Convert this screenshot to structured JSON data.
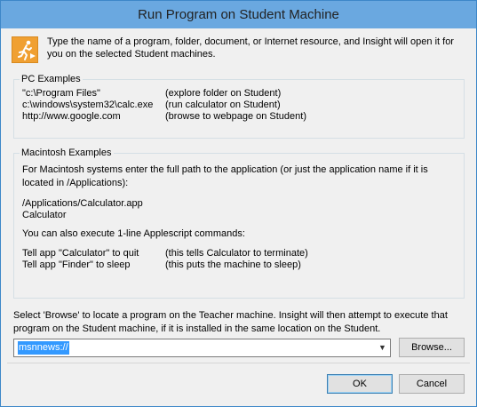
{
  "window": {
    "title": "Run Program on Student Machine"
  },
  "intro": "Type the name of a program, folder, document, or Internet resource, and Insight will open it for you on the selected Student machines.",
  "pc": {
    "label": "PC Examples",
    "rows": [
      {
        "cmd": "\"c:\\Program Files\"",
        "desc": "(explore folder on Student)"
      },
      {
        "cmd": "c:\\windows\\system32\\calc.exe",
        "desc": "(run calculator on Student)"
      },
      {
        "cmd": "http://www.google.com",
        "desc": "(browse to webpage on Student)"
      }
    ]
  },
  "mac": {
    "label": "Macintosh Examples",
    "text1": "For Macintosh systems enter the full path to the application (or just the application name if it is",
    "text1b": "located in /Applications):",
    "path1": "/Applications/Calculator.app",
    "path2": "Calculator",
    "text2": "You can also execute 1-line Applescript commands:",
    "rows": [
      {
        "cmd": "Tell app \"Calculator\" to quit",
        "desc": "(this tells Calculator to terminate)"
      },
      {
        "cmd": "Tell app \"Finder\" to sleep",
        "desc": "(this puts the machine to sleep)"
      }
    ]
  },
  "browse": {
    "desc1": "Select 'Browse' to locate a program on the Teacher machine. Insight will then attempt to execute that",
    "desc2": "program on the Student machine, if it is installed in the same location on the Student."
  },
  "command": {
    "value": "msnnews://"
  },
  "buttons": {
    "browse": "Browse...",
    "ok": "OK",
    "cancel": "Cancel"
  },
  "icons": {
    "app": "run-program-icon",
    "dropdown": "chevron-down-icon"
  },
  "colors": {
    "titlebar": "#6aa8e0",
    "icon_bg": "#f0a032",
    "selection": "#3399ff"
  }
}
